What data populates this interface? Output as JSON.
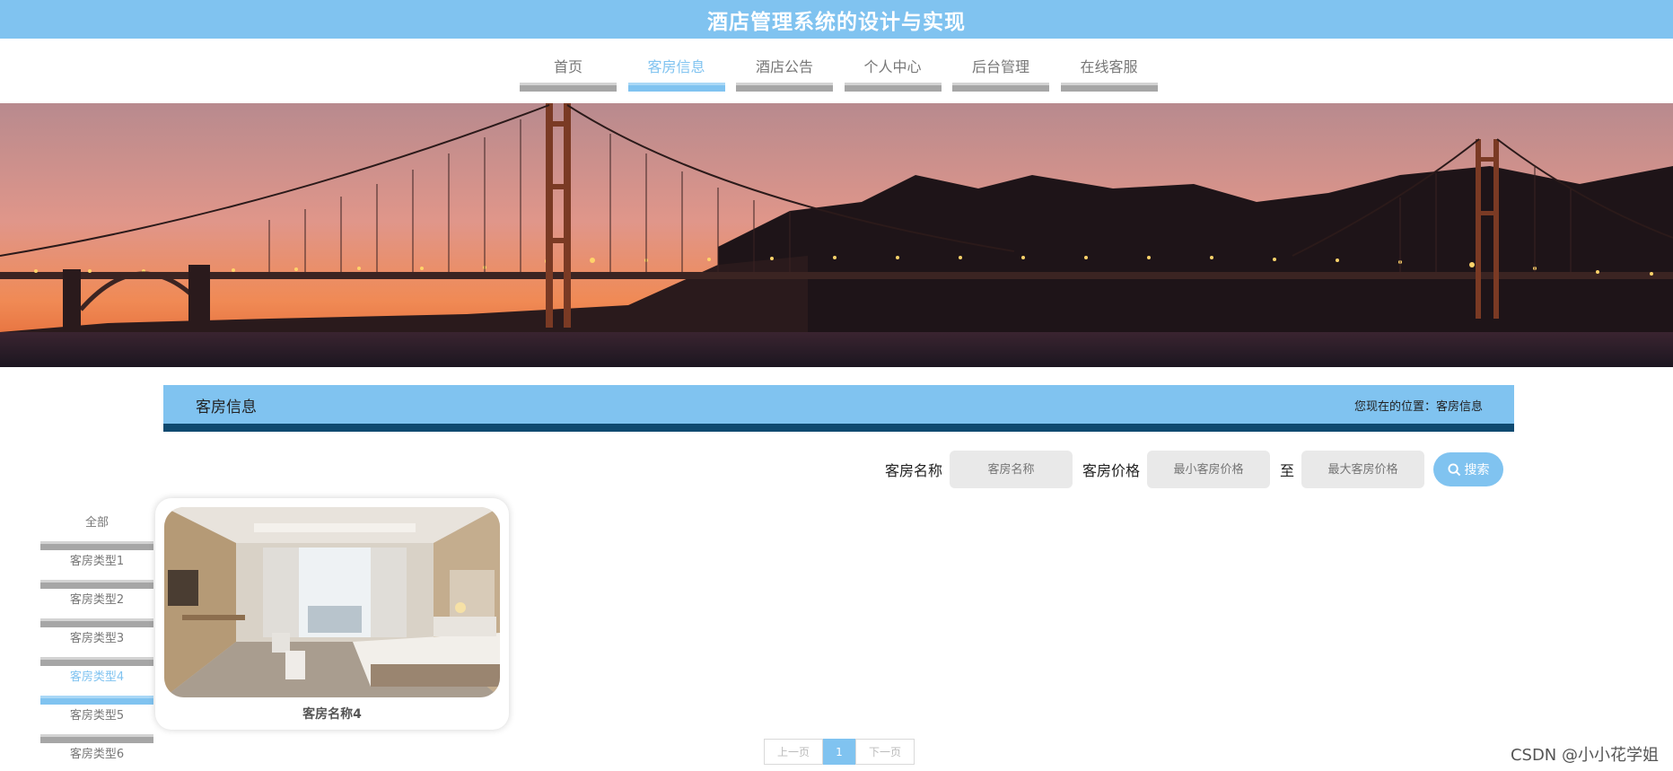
{
  "header": {
    "title": "酒店管理系统的设计与实现"
  },
  "nav": {
    "items": [
      {
        "label": "首页",
        "active": false
      },
      {
        "label": "客房信息",
        "active": true
      },
      {
        "label": "酒店公告",
        "active": false
      },
      {
        "label": "个人中心",
        "active": false
      },
      {
        "label": "后台管理",
        "active": false
      },
      {
        "label": "在线客服",
        "active": false
      }
    ]
  },
  "section": {
    "title": "客房信息",
    "breadcrumb": "您现在的位置：客房信息"
  },
  "search": {
    "name_label": "客房名称",
    "name_placeholder": "客房名称",
    "price_label": "客房价格",
    "min_placeholder": "最小客房价格",
    "to_label": "至",
    "max_placeholder": "最大客房价格",
    "button_label": "搜索"
  },
  "sidebar": {
    "items": [
      {
        "label": "全部",
        "active": false
      },
      {
        "label": "客房类型1",
        "active": false
      },
      {
        "label": "客房类型2",
        "active": false
      },
      {
        "label": "客房类型3",
        "active": false
      },
      {
        "label": "客房类型4",
        "active": true
      },
      {
        "label": "客房类型5",
        "active": false
      },
      {
        "label": "客房类型6",
        "active": false
      }
    ]
  },
  "rooms": [
    {
      "name": "客房名称4"
    }
  ],
  "pagination": {
    "prev": "上一页",
    "current": "1",
    "next": "下一页"
  },
  "watermark": "CSDN @小小花学姐",
  "colors": {
    "accent": "#80c3f0",
    "dark_accent": "#0f4a70",
    "inactive_bar": "#a6a6a6"
  }
}
